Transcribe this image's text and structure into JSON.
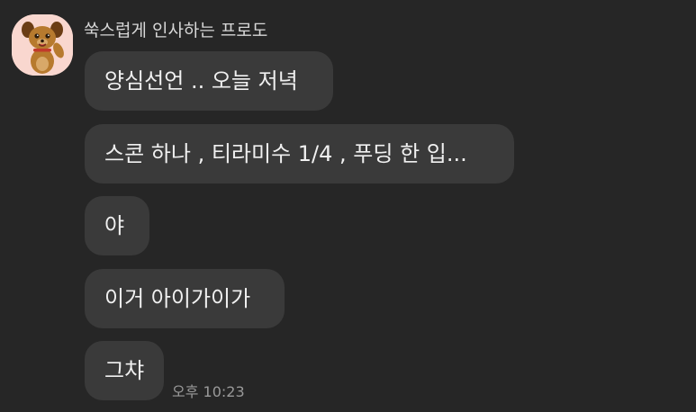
{
  "chat": {
    "sender_name": "쑥스럽게 인사하는 프로도",
    "avatar_icon": "frodo-dog-avatar-icon",
    "messages": [
      {
        "text": "양심선언 .. 오늘 저녁"
      },
      {
        "text": "스콘 하나 , 티라미수 1/4 , 푸딩 한 입..."
      },
      {
        "text": "야"
      },
      {
        "text": "이거 아이가이가"
      },
      {
        "text": "그챠"
      }
    ],
    "timestamp": "오후 10:23"
  },
  "colors": {
    "background": "#262626",
    "bubble": "#3a3a3a",
    "bubble_text": "#f0f0f0",
    "sender_text": "#d7d7d7",
    "timestamp_text": "#9a9a9a",
    "avatar_bg": "#f9d7cf"
  }
}
